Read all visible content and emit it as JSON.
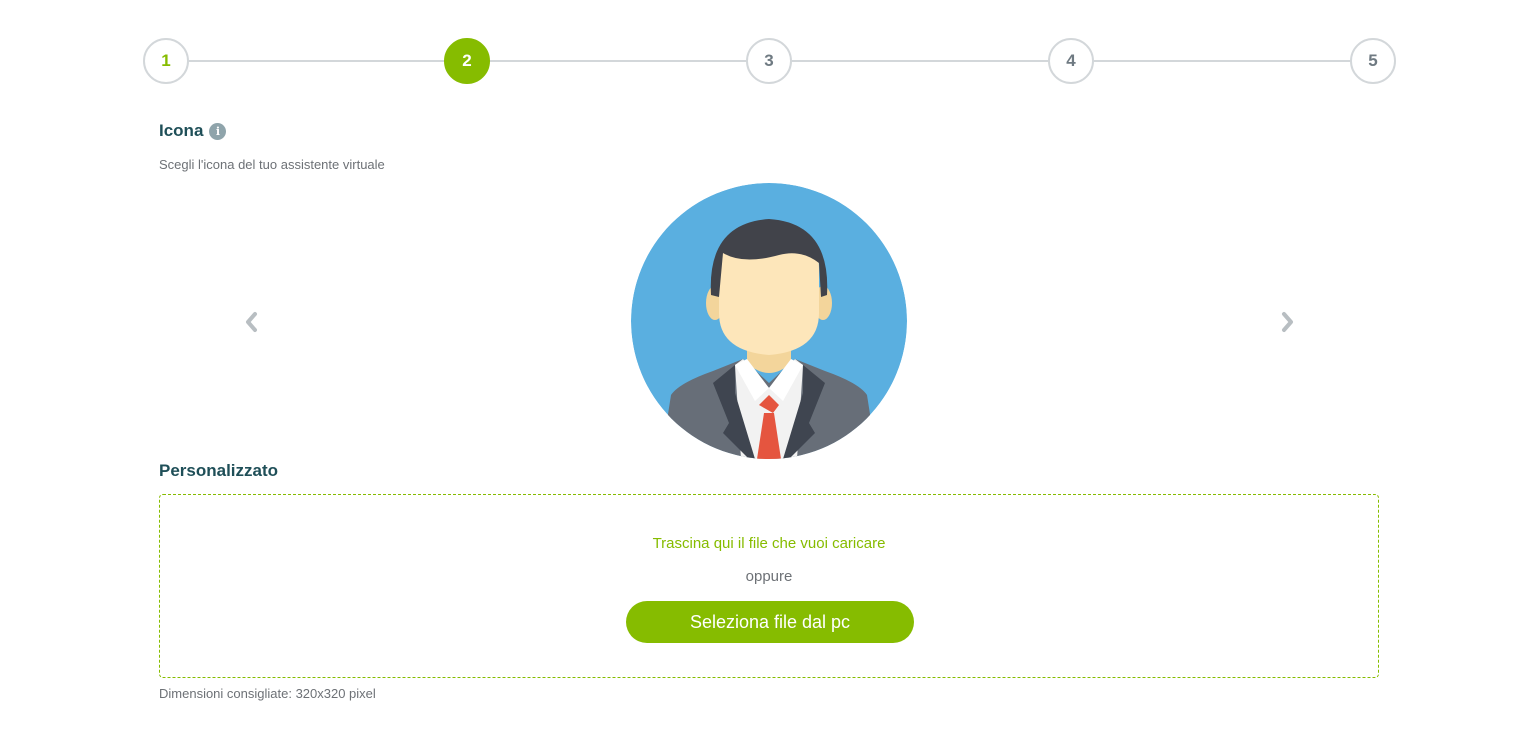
{
  "stepper": {
    "steps": [
      {
        "label": "1",
        "state": "done"
      },
      {
        "label": "2",
        "state": "active"
      },
      {
        "label": "3",
        "state": "pending"
      },
      {
        "label": "4",
        "state": "pending"
      },
      {
        "label": "5",
        "state": "pending"
      }
    ]
  },
  "icon_section": {
    "title": "Icona",
    "info_icon": "info-icon",
    "subtitle": "Scegli l'icona del tuo assistente virtuale",
    "prev_icon": "chevron-left-icon",
    "next_icon": "chevron-right-icon",
    "selected_avatar": "businessman-avatar"
  },
  "custom_section": {
    "title": "Personalizzato",
    "drop_text": "Trascina qui il file che vuoi caricare",
    "or_text": "oppure",
    "select_button": "Seleziona file dal pc",
    "hint": "Dimensioni consigliate: 320x320 pixel"
  },
  "colors": {
    "accent": "#86bc00",
    "heading": "#1f4f58",
    "avatar_background": "#5aafe0"
  }
}
